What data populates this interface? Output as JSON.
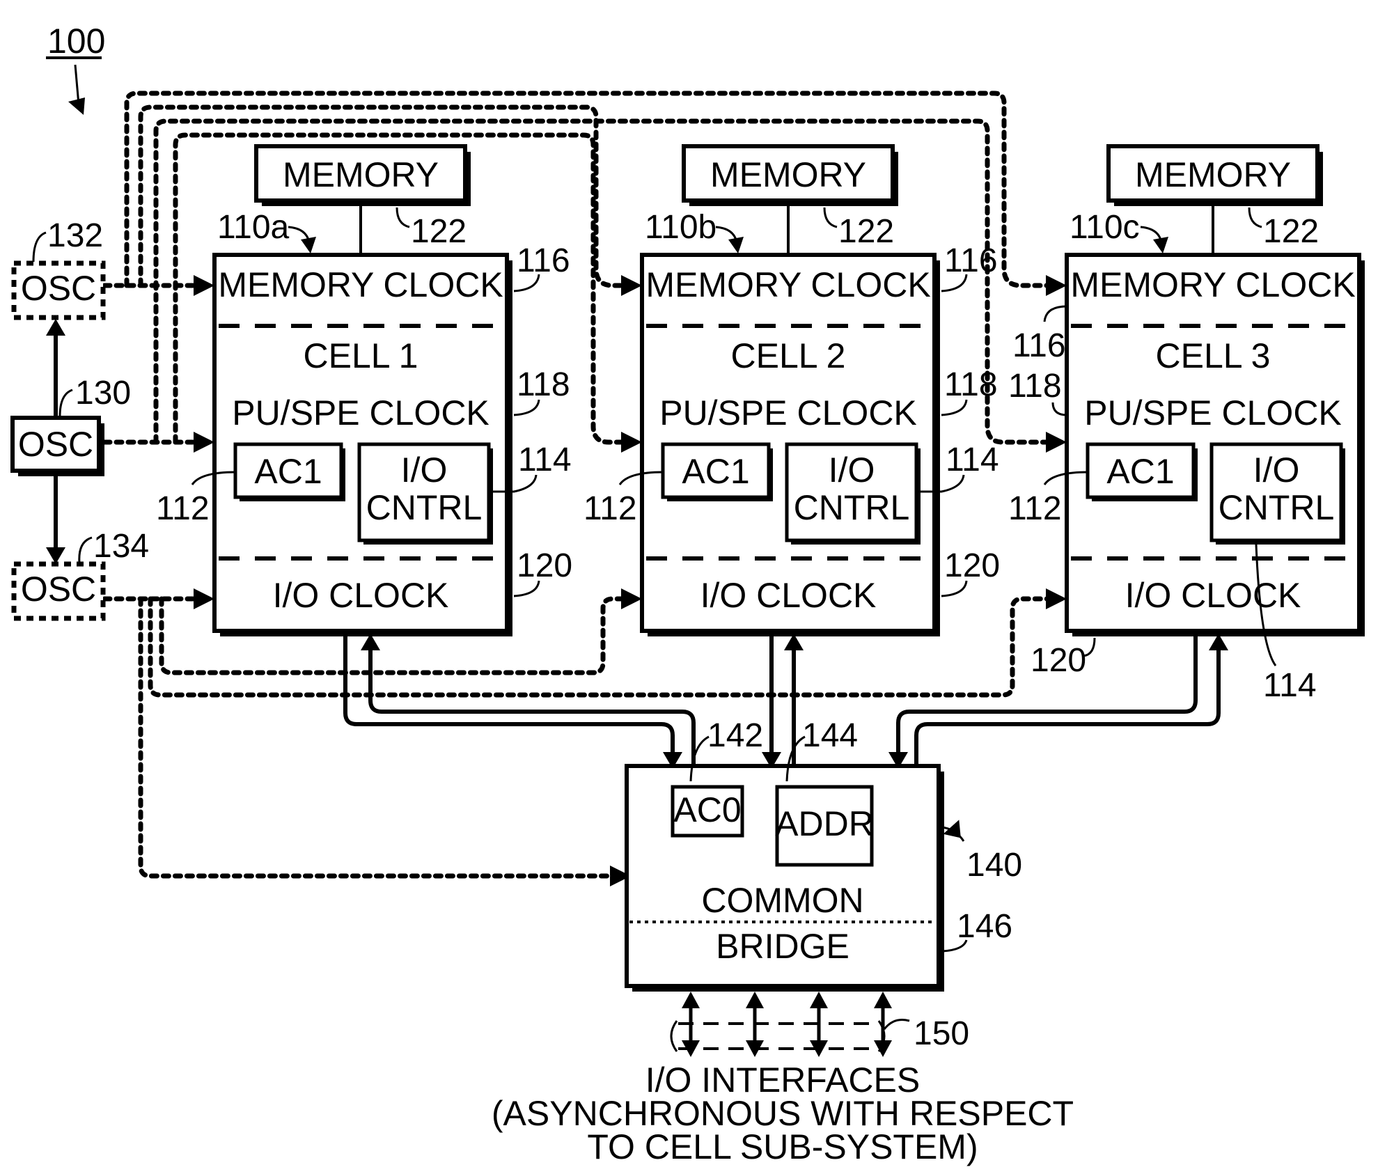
{
  "figure": {
    "ref": "100"
  },
  "oscillators": [
    {
      "ref": "132",
      "label": "OSC",
      "style": "dashed"
    },
    {
      "ref": "130",
      "label": "OSC",
      "style": "solid"
    },
    {
      "ref": "134",
      "label": "OSC",
      "style": "dashed"
    }
  ],
  "cells": [
    {
      "ref": "110a",
      "memory_label": "MEMORY",
      "memory_ref": "122",
      "memory_clock": "MEMORY CLOCK",
      "memory_clock_ref": "116",
      "name": "CELL 1",
      "pu_spe_clock": "PU/SPE CLOCK",
      "pu_spe_clock_ref": "118",
      "ac_label": "AC1",
      "ac_ref": "112",
      "io_cntrl_line1": "I/O",
      "io_cntrl_line2": "CNTRL",
      "io_cntrl_ref": "114",
      "io_clock": "I/O CLOCK",
      "io_clock_ref": "120"
    },
    {
      "ref": "110b",
      "memory_label": "MEMORY",
      "memory_ref": "122",
      "memory_clock": "MEMORY CLOCK",
      "memory_clock_ref": "116",
      "name": "CELL 2",
      "pu_spe_clock": "PU/SPE CLOCK",
      "pu_spe_clock_ref": "118",
      "ac_label": "AC1",
      "ac_ref": "112",
      "io_cntrl_line1": "I/O",
      "io_cntrl_line2": "CNTRL",
      "io_cntrl_ref": "114",
      "io_clock": "I/O CLOCK",
      "io_clock_ref": "120"
    },
    {
      "ref": "110c",
      "memory_label": "MEMORY",
      "memory_ref": "122",
      "memory_clock": "MEMORY CLOCK",
      "memory_clock_ref": "116",
      "name": "CELL 3",
      "pu_spe_clock": "PU/SPE CLOCK",
      "pu_spe_clock_ref": "118",
      "ac_label": "AC1",
      "ac_ref": "112",
      "io_cntrl_line1": "I/O",
      "io_cntrl_line2": "CNTRL",
      "io_cntrl_ref": "114",
      "io_clock": "I/O CLOCK",
      "io_clock_ref": "120"
    }
  ],
  "bridge": {
    "ref": "140",
    "ac_label": "AC0",
    "ac_ref": "142",
    "addr_label": "ADDR",
    "addr_ref": "144",
    "common_label": "COMMON",
    "bridge_label": "BRIDGE",
    "bridge_ref": "146"
  },
  "io_interfaces": {
    "ref": "150",
    "count": 4,
    "line1": "I/O INTERFACES",
    "line2": "(ASYNCHRONOUS WITH RESPECT",
    "line3": "TO CELL SUB-SYSTEM)"
  }
}
